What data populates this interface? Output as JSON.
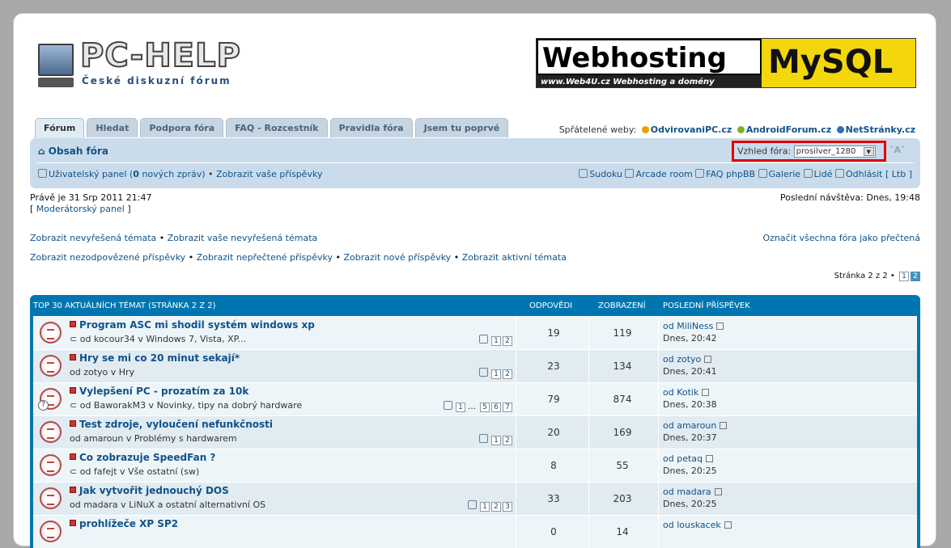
{
  "header": {
    "logo_name": "PC-HELP",
    "logo_subtitle": "České diskuzní fórum",
    "banner": {
      "left": "Webhosting",
      "right": "MySQL",
      "tagline": "www.Web4U.cz  Webhosting a domény"
    }
  },
  "tabs": [
    "Fórum",
    "Hledat",
    "Podpora fóra",
    "FAQ - Rozcestník",
    "Pravidla fóra",
    "Jsem tu poprvé"
  ],
  "friends": {
    "label": "Spřátelené weby:",
    "links": [
      "OdvirovaniPC.cz",
      "AndroidForum.cz",
      "NetStránky.cz"
    ],
    "colors": [
      "#e8a000",
      "#7ab230",
      "#2f6fb5"
    ]
  },
  "navbar": {
    "crumb": "Obsah fóra",
    "style_label": "Vzhled fóra:",
    "style_value": "prosilver_1280",
    "font_size": "A",
    "user_panel_pre": "Uživatelský panel (",
    "new_messages": "0",
    "user_panel_post": " nových zpráv)",
    "bullet": "•",
    "your_posts": "Zobrazit vaše příspěvky",
    "right_links": [
      "Sudoku",
      "Arcade room",
      "FAQ phpBB",
      "Galerie",
      "Lidé",
      "Odhlásit [ Ltb ]"
    ]
  },
  "info": {
    "now": "Právě je 31 Srp 2011 21:47",
    "last_visit": "Poslední návštěva: Dnes, 19:48",
    "mod_panel_open": "[",
    "mod_panel": "Moderátorský panel",
    "mod_panel_close": "]"
  },
  "links1": [
    "Zobrazit nevyřešená témata",
    "Zobrazit vaše nevyřešená témata"
  ],
  "mark_read": "Označit všechna fóra jako přečtená",
  "links2": [
    "Zobrazit nezodpovězené příspěvky",
    "Zobrazit nepřečtené příspěvky",
    "Zobrazit nové příspěvky",
    "Zobrazit aktivní témata"
  ],
  "pagination": {
    "label": "Stránka 2 z 2 •",
    "pages": [
      "1",
      "2"
    ]
  },
  "table": {
    "headers": [
      "Top 30 aktuálních témat (Stránka 2 z 2)",
      "Odpovědi",
      "Zobrazení",
      "Poslední příspěvek"
    ],
    "rows": [
      {
        "title": "Program ASC mi shodil systém windows xp",
        "meta": "od kocour34 v Windows 7, Vista, XP...",
        "attach": true,
        "pages": [
          "1",
          "2"
        ],
        "replies": "19",
        "views": "119",
        "last_by": "od MiliNess",
        "last_time": "Dnes, 20:42"
      },
      {
        "title": "Hry se mi co 20 minut sekají*",
        "meta": "od zotyo v Hry",
        "attach": false,
        "pages": [
          "1",
          "2"
        ],
        "replies": "23",
        "views": "134",
        "last_by": "od zotyo",
        "last_time": "Dnes, 20:41"
      },
      {
        "title": "Vylepšení PC - prozatím za 10k",
        "meta": "od BaworakM3 v Novinky, tipy na dobrý hardware",
        "attach": true,
        "pages": [
          "1",
          "…",
          "5",
          "6",
          "7"
        ],
        "replies": "79",
        "views": "874",
        "last_by": "od Kotik",
        "last_time": "Dnes, 20:38",
        "question": true
      },
      {
        "title": "Test zdroje, vyloučení nefunkčnosti",
        "meta": "od amaroun v Problémy s hardwarem",
        "attach": false,
        "pages": [
          "1",
          "2"
        ],
        "replies": "20",
        "views": "169",
        "last_by": "od amaroun",
        "last_time": "Dnes, 20:37"
      },
      {
        "title": "Co zobrazuje SpeedFan ?",
        "meta": "od fafejt v Vše ostatní (sw)",
        "attach": true,
        "pages": [],
        "replies": "8",
        "views": "55",
        "last_by": "od petaq",
        "last_time": "Dnes, 20:25"
      },
      {
        "title": "Jak vytvořit jednouchý DOS",
        "meta": "od madara v LiNuX a ostatní alternativní OS",
        "attach": false,
        "pages": [
          "1",
          "2",
          "3"
        ],
        "replies": "33",
        "views": "203",
        "last_by": "od madara",
        "last_time": "Dnes, 20:25"
      },
      {
        "title": "prohlížeče XP SP2",
        "meta": "",
        "attach": false,
        "pages": [],
        "replies": "0",
        "views": "14",
        "last_by": "od louskacek",
        "last_time": ""
      }
    ]
  }
}
